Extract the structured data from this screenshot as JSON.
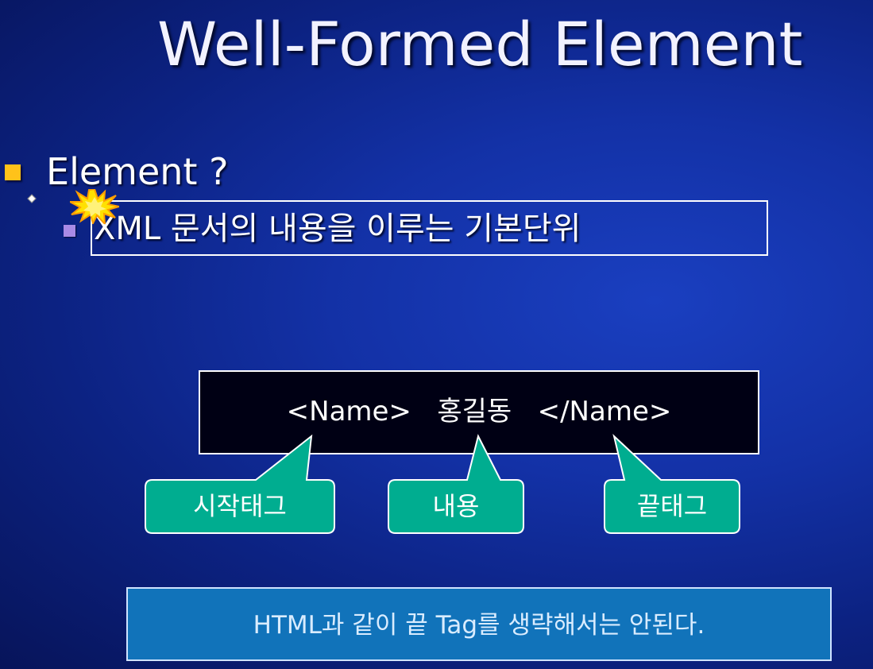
{
  "slide": {
    "title": "Well-Formed Element",
    "bullet": "Element ?",
    "sub_bullet": "XML 문서의 내용을 이루는 기본단위"
  },
  "example": {
    "code": "<Name>   홍길동   </Name>"
  },
  "callouts": {
    "start_tag": "시작태그",
    "content": "내용",
    "end_tag": "끝태그"
  },
  "note": "HTML과 같이 끝 Tag를 생략해서는 안된다.",
  "colors": {
    "background": "#1331a6",
    "bullet": "#ffc21a",
    "sub_bullet": "#a98ae6",
    "callout": "#00ad90",
    "note_box": "#1173ba"
  }
}
